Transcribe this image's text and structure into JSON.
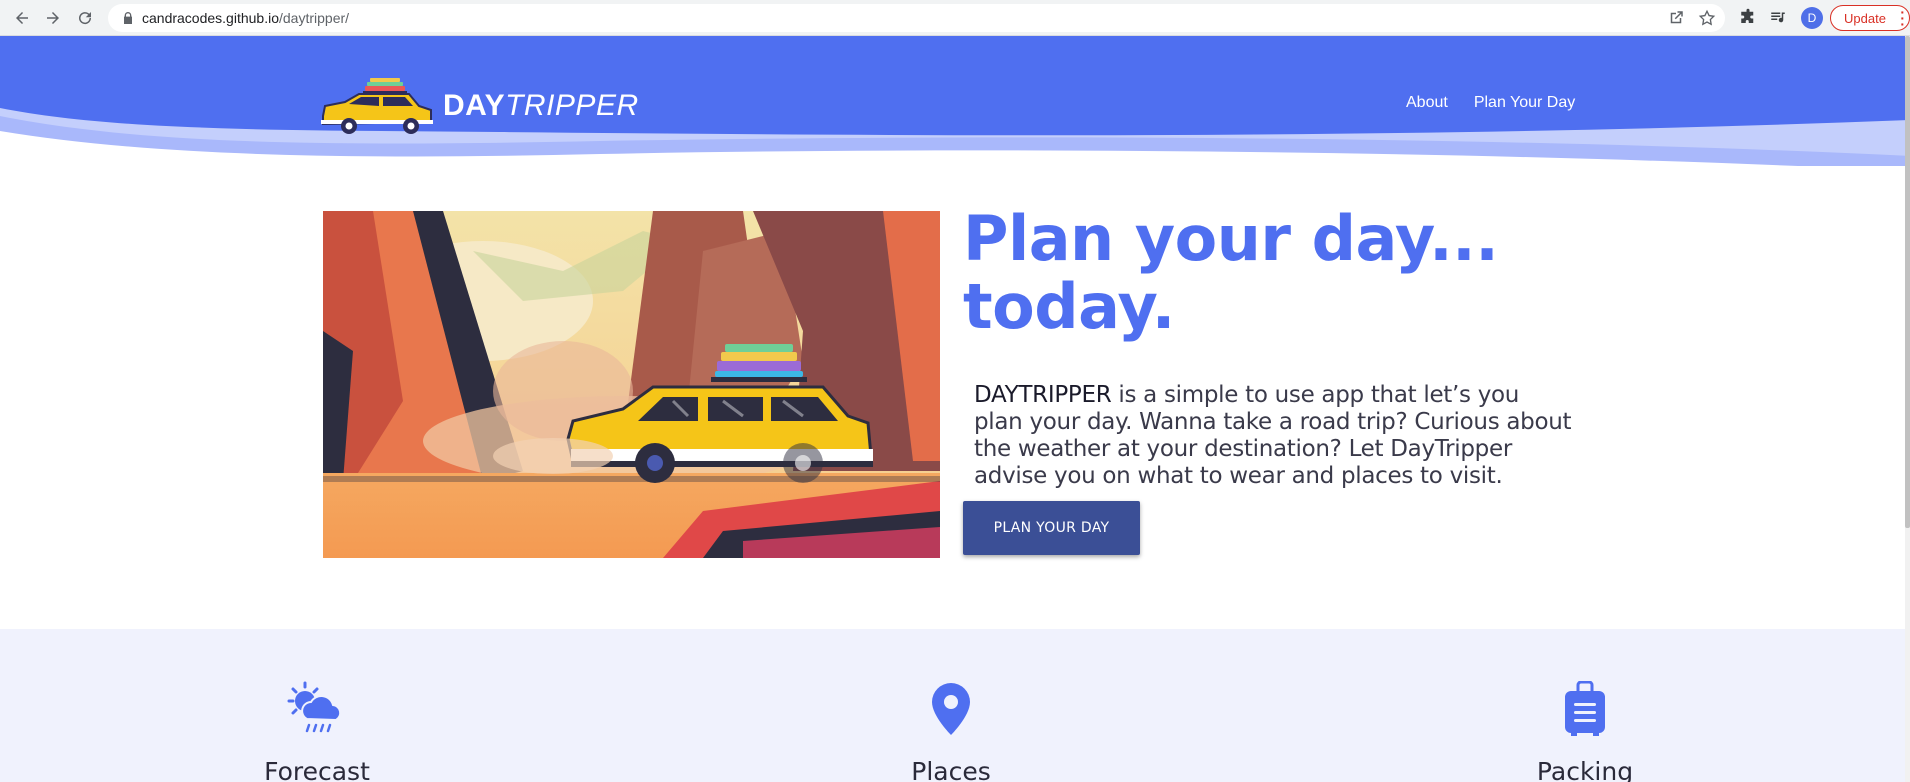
{
  "browser": {
    "url_host": "candracodes.github.io",
    "url_path": "/daytripper/",
    "avatar_letter": "D",
    "update_label": "Update"
  },
  "header": {
    "logo_bold": "DAY",
    "logo_light": "TRIPPER",
    "nav": [
      "About",
      "Plan Your Day"
    ]
  },
  "hero": {
    "title_line1": "Plan your day...",
    "title_line2": "today.",
    "brand_word": "DAYTRIPPER",
    "description": " is a simple to use app that let’s you plan your day. Wanna take a road trip? Curious about the weather at your destination? Let DayTripper advise you on what to wear and places to visit.",
    "cta_label": "PLAN YOUR DAY"
  },
  "features": [
    {
      "label": "Forecast",
      "icon": "weather-sun-cloud-rain-icon"
    },
    {
      "label": "Places",
      "icon": "map-pin-icon"
    },
    {
      "label": "Packing",
      "icon": "suitcase-icon"
    }
  ],
  "colors": {
    "brand_blue": "#4f6ff0",
    "button_navy": "#3b4f96",
    "feature_bg": "#f0f2fd"
  }
}
